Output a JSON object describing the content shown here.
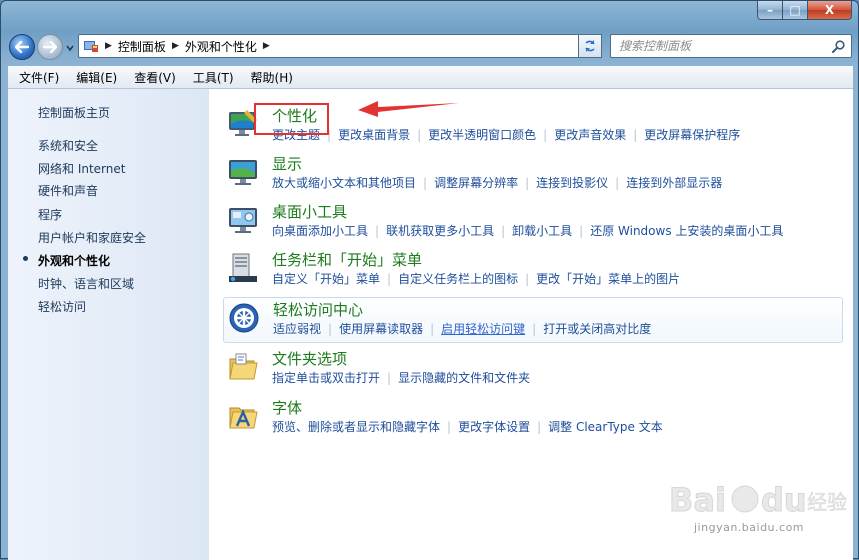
{
  "window": {
    "caption_buttons": {
      "minimize": "–",
      "maximize": "□",
      "close": "X"
    }
  },
  "nav": {
    "breadcrumb": [
      "控制面板",
      "外观和个性化"
    ],
    "search_placeholder": "搜索控制面板"
  },
  "menubar": [
    "文件(F)",
    "编辑(E)",
    "查看(V)",
    "工具(T)",
    "帮助(H)"
  ],
  "sidebar": {
    "items": [
      {
        "label": "控制面板主页",
        "current": false
      },
      {
        "label": "系统和安全",
        "current": false
      },
      {
        "label": "网络和 Internet",
        "current": false
      },
      {
        "label": "硬件和声音",
        "current": false
      },
      {
        "label": "程序",
        "current": false
      },
      {
        "label": "用户帐户和家庭安全",
        "current": false
      },
      {
        "label": "外观和个性化",
        "current": true
      },
      {
        "label": "时钟、语言和区域",
        "current": false
      },
      {
        "label": "轻松访问",
        "current": false
      }
    ]
  },
  "categories": [
    {
      "title": "个性化",
      "icon": "personalization-icon",
      "links": [
        "更改主题",
        "更改桌面背景",
        "更改半透明窗口颜色",
        "更改声音效果",
        "更改屏幕保护程序"
      ]
    },
    {
      "title": "显示",
      "icon": "display-icon",
      "links": [
        "放大或缩小文本和其他项目",
        "调整屏幕分辨率",
        "连接到投影仪",
        "连接到外部显示器"
      ]
    },
    {
      "title": "桌面小工具",
      "icon": "gadgets-icon",
      "links": [
        "向桌面添加小工具",
        "联机获取更多小工具",
        "卸载小工具",
        "还原 Windows 上安装的桌面小工具"
      ]
    },
    {
      "title": "任务栏和「开始」菜单",
      "icon": "taskbar-icon",
      "links": [
        "自定义「开始」菜单",
        "自定义任务栏上的图标",
        "更改「开始」菜单上的图片"
      ]
    },
    {
      "title": "轻松访问中心",
      "icon": "ease-of-access-icon",
      "highlighted": true,
      "links": [
        "适应弱视",
        "使用屏幕读取器",
        "启用轻松访问键",
        "打开或关闭高对比度"
      ]
    },
    {
      "title": "文件夹选项",
      "icon": "folder-options-icon",
      "links": [
        "指定单击或双击打开",
        "显示隐藏的文件和文件夹"
      ]
    },
    {
      "title": "字体",
      "icon": "fonts-icon",
      "links": [
        "预览、删除或者显示和隐藏字体",
        "更改字体设置",
        "调整 ClearType 文本"
      ]
    }
  ],
  "watermark": {
    "logo": "Baidu经验",
    "url": "jingyan.baidu.com"
  },
  "colors": {
    "link": "#1e4e9a",
    "category_title": "#1e7b1e",
    "annotation": "#e23232",
    "sidebar_text": "#1e395b"
  }
}
